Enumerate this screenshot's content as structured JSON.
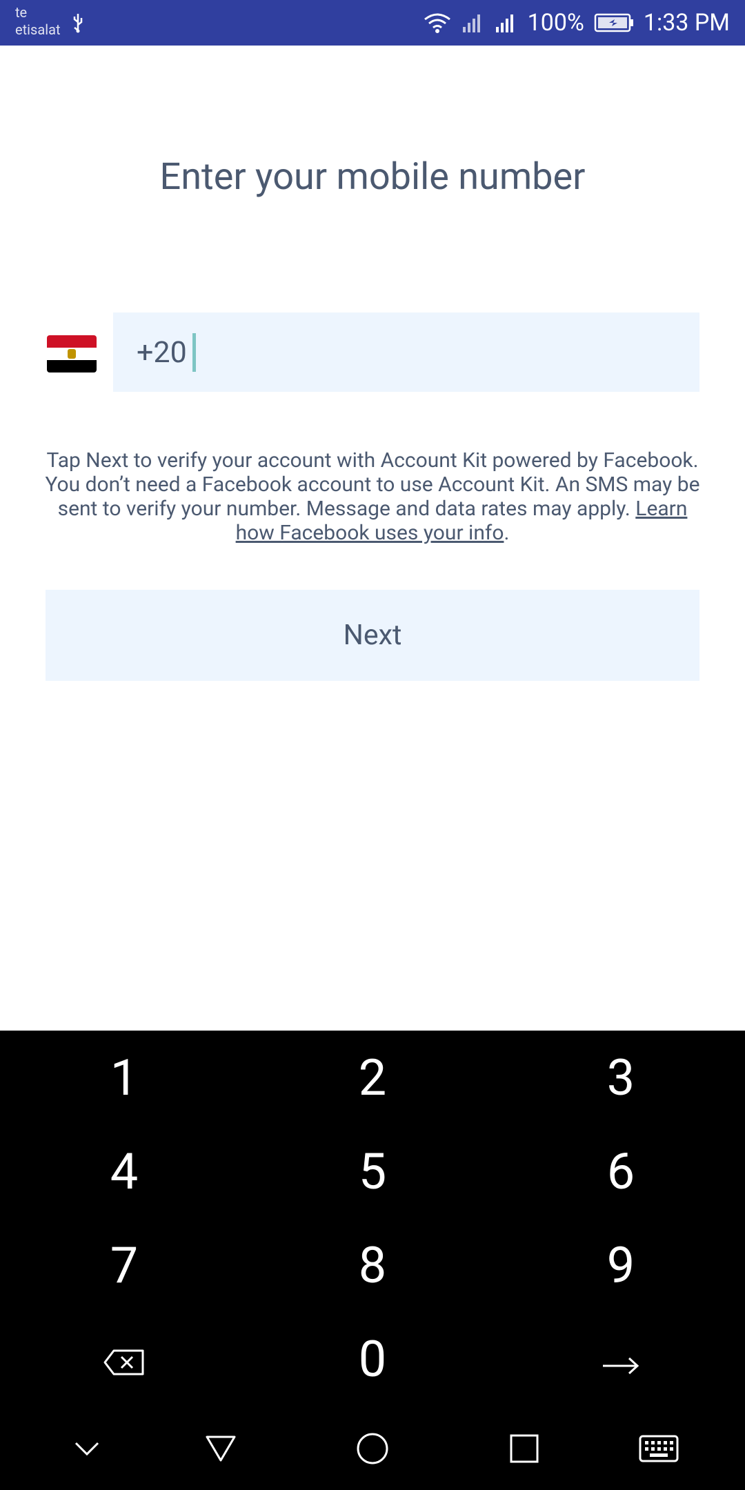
{
  "status_bar": {
    "carrier_line1": "te",
    "carrier_line2": "etisalat",
    "battery": "100%",
    "time": "1:33 PM",
    "icons": [
      "usb-icon",
      "wifi-icon",
      "signal-icon",
      "signal-icon",
      "battery-charging-icon"
    ]
  },
  "screen": {
    "title": "Enter your mobile number",
    "country_flag": "flag-egypt",
    "phone_prefix": "+20",
    "disclaimer_text": "Tap Next to verify your account with Account Kit powered by Facebook. You don’t need a Facebook account to use Account Kit. An SMS may be sent to verify your number. Message and data rates may apply. ",
    "disclaimer_link": "Learn how Facebook uses your info",
    "disclaimer_end": ".",
    "next_label": "Next"
  },
  "keypad": {
    "keys": [
      "1",
      "2",
      "3",
      "4",
      "5",
      "6",
      "7",
      "8",
      "9",
      "0"
    ],
    "backspace_icon": "backspace-icon",
    "enter_icon": "arrow-right-icon"
  },
  "nav_bar": {
    "icons": [
      "chevron-down-icon",
      "back-triangle-icon",
      "home-circle-icon",
      "recents-square-icon",
      "keyboard-icon"
    ]
  },
  "colors": {
    "status_bar": "#303f9f",
    "text": "#4b5970",
    "input_bg": "#edf5fe",
    "cursor": "#7ec5c4",
    "keypad_bg": "#000000"
  }
}
